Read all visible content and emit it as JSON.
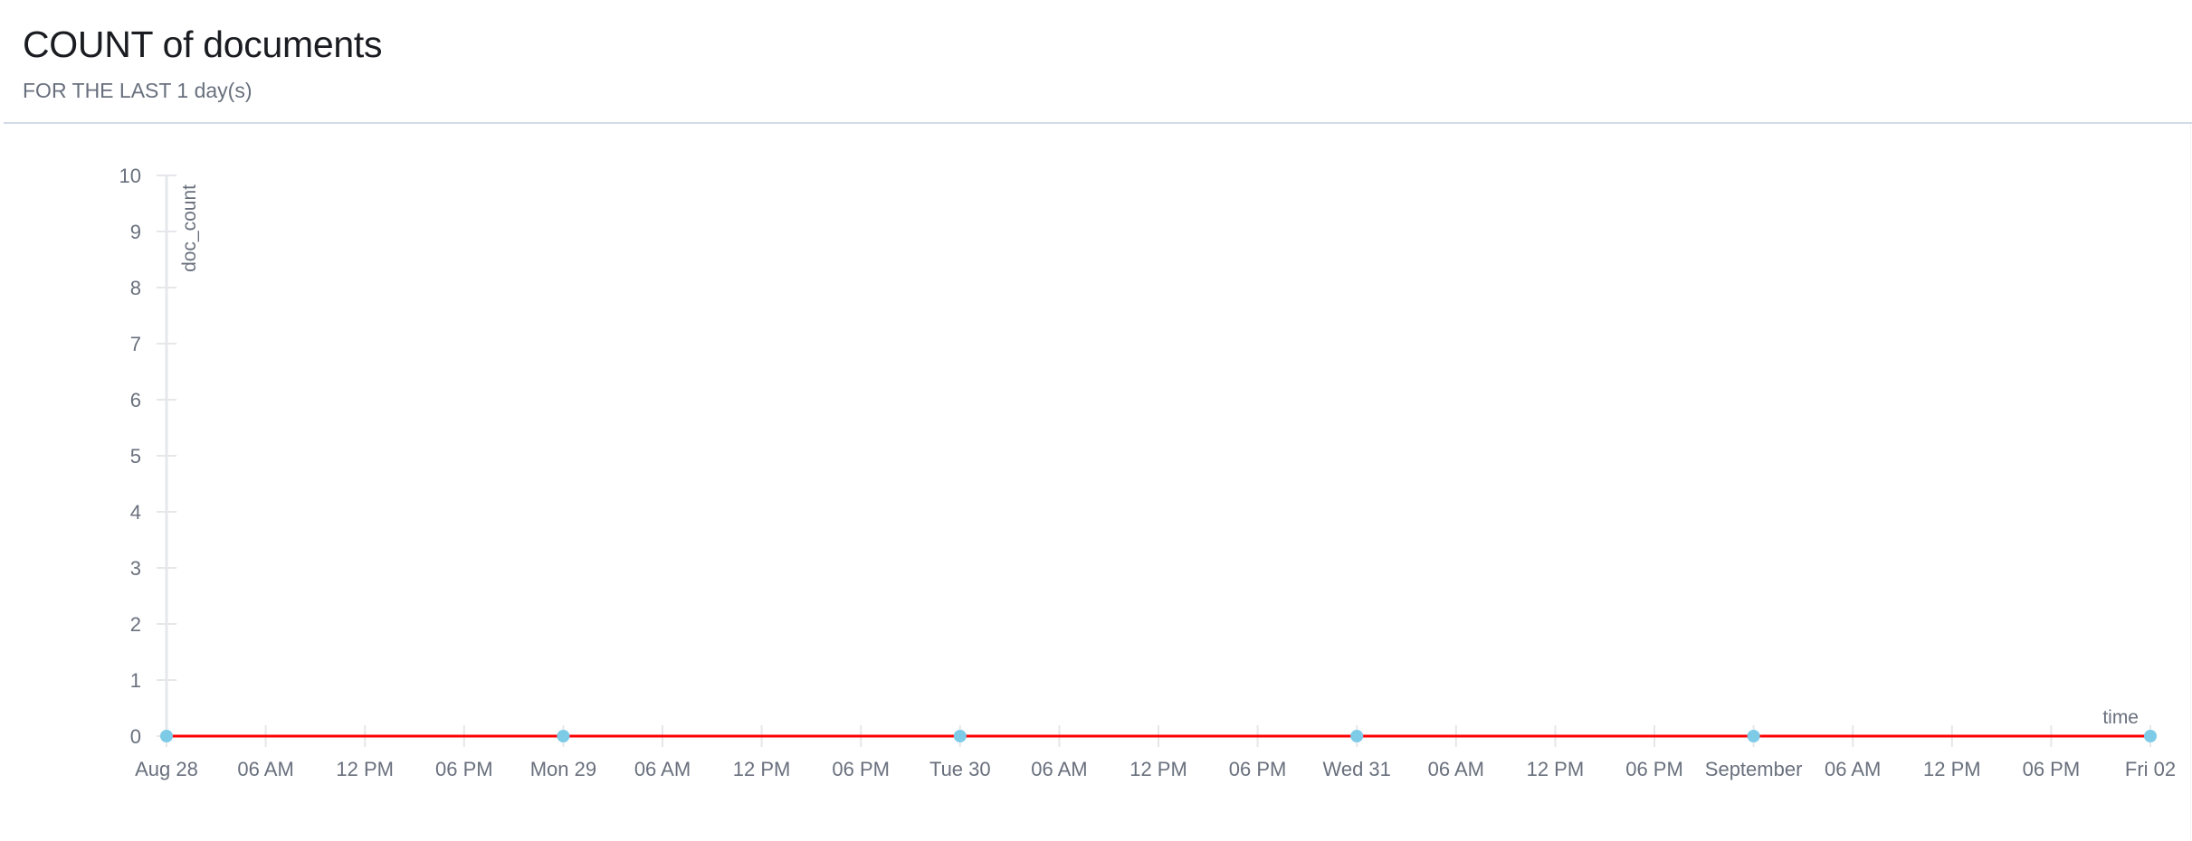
{
  "header": {
    "title": "COUNT of documents",
    "subtitle": "FOR THE LAST 1 day(s)"
  },
  "colors": {
    "line": "#ff0000",
    "point": "#7ecbe8",
    "axis": "#e6e7ea",
    "grid_tick": "#e6e7ea",
    "text": "#69707d",
    "title": "#1a1c21",
    "divider": "#d3dae6"
  },
  "chart_data": {
    "type": "line",
    "title": "COUNT of documents",
    "subtitle": "FOR THE LAST 1 day(s)",
    "xlabel": "time",
    "ylabel": "doc_count",
    "ylim": [
      0,
      10
    ],
    "y_ticks": [
      0,
      1,
      2,
      3,
      4,
      5,
      6,
      7,
      8,
      9,
      10
    ],
    "x_range_hours": [
      0,
      120
    ],
    "x_tick_step_hours": 6,
    "x_tick_labels": [
      "Aug 28",
      "06 AM",
      "12 PM",
      "06 PM",
      "Mon 29",
      "06 AM",
      "12 PM",
      "06 PM",
      "Tue 30",
      "06 AM",
      "12 PM",
      "06 PM",
      "Wed 31",
      "06 AM",
      "12 PM",
      "06 PM",
      "September",
      "06 AM",
      "12 PM",
      "06 PM",
      "Fri 02"
    ],
    "grid": false,
    "legend": "none",
    "series": [
      {
        "name": "doc_count",
        "x": [
          "Aug 28",
          "Mon 29",
          "Tue 30",
          "Wed 31",
          "September",
          "Fri 02"
        ],
        "x_hours": [
          0,
          24,
          48,
          72,
          96,
          120
        ],
        "values": [
          0,
          0,
          0,
          0,
          0,
          0
        ]
      }
    ]
  }
}
